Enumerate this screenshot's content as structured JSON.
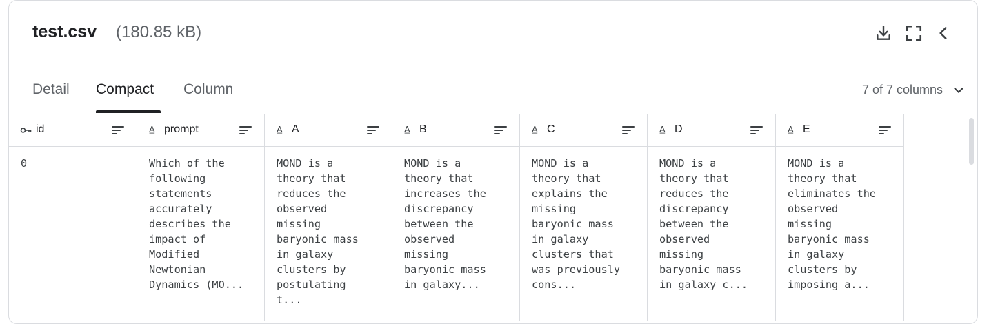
{
  "file": {
    "name": "test.csv",
    "size": "(180.85 kB)"
  },
  "header_icons": [
    "download-icon",
    "fullscreen-icon",
    "collapse-chevron-icon"
  ],
  "tabs": [
    {
      "label": "Detail",
      "active": false
    },
    {
      "label": "Compact",
      "active": true
    },
    {
      "label": "Column",
      "active": false
    }
  ],
  "column_count": "7 of 7 columns",
  "columns": [
    {
      "name": "id",
      "type_icon": "key-icon"
    },
    {
      "name": "prompt",
      "type_icon": "text-type-icon"
    },
    {
      "name": "A",
      "type_icon": "text-type-icon"
    },
    {
      "name": "B",
      "type_icon": "text-type-icon"
    },
    {
      "name": "C",
      "type_icon": "text-type-icon"
    },
    {
      "name": "D",
      "type_icon": "text-type-icon"
    },
    {
      "name": "E",
      "type_icon": "text-type-icon"
    }
  ],
  "rows": [
    {
      "id": "0",
      "prompt": "Which of the\nfollowing\nstatements\naccurately\ndescribes the\nimpact of\nModified\nNewtonian\nDynamics (MO...",
      "A": "MOND is a\ntheory that\nreduces the\nobserved\nmissing\nbaryonic mass\nin galaxy\nclusters by\npostulating\nt...",
      "B": "MOND is a\ntheory that\nincreases the\ndiscrepancy\nbetween the\nobserved\nmissing\nbaryonic mass\nin galaxy...",
      "C": "MOND is a\ntheory that\nexplains the\nmissing\nbaryonic mass\nin galaxy\nclusters that\nwas previously\ncons...",
      "D": "MOND is a\ntheory that\nreduces the\ndiscrepancy\nbetween the\nobserved\nmissing\nbaryonic mass\nin galaxy c...",
      "E": "MOND is a\ntheory that\neliminates the\nobserved\nmissing\nbaryonic mass\nin galaxy\nclusters by\nimposing a..."
    }
  ]
}
